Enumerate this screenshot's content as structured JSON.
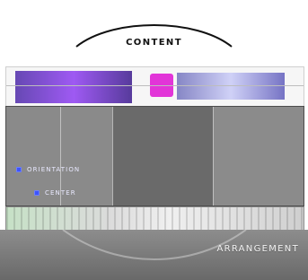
{
  "header": {
    "title": "CONTENT"
  },
  "mid": {
    "buttons": [
      {
        "label": "ORIENTATION"
      },
      {
        "label": "CENTER"
      }
    ]
  },
  "footer": {
    "brand": "ARRANGEMENT"
  },
  "colors": {
    "button_icon": "#3d54ff",
    "panel_dark": "#6a6a6a",
    "panel_mid": "#8a8a8a",
    "footer": "#808080"
  },
  "icons": [
    "square-icon"
  ]
}
